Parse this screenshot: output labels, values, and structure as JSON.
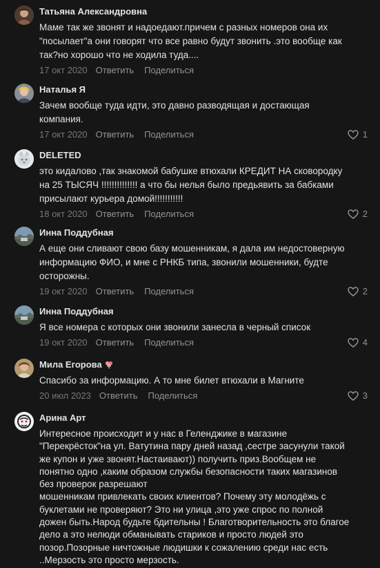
{
  "comments": [
    {
      "author": "Татьяна Александровна",
      "text": "Маме так же звонят и надоедают.причем с разных номеров она их\n\"посылает\"а они говорят что все равно будут звонить .это вообще как\nтак?но хорошо что не ходила туда....",
      "date": "17 окт 2020",
      "reply": "Ответить",
      "share": "Поделиться",
      "likes": ""
    },
    {
      "author": "Наталья Я",
      "text": "Зачем вообще туда идти, это давно разводящая и достающая\nкомпания.",
      "date": "17 окт 2020",
      "reply": "Ответить",
      "share": "Поделиться",
      "likes": "1"
    },
    {
      "author": "DELETED",
      "text": "это кидалово ,так знакомой бабушке втюхали КРЕДИТ НА сковородку\nна 25 ТЫСЯЧ !!!!!!!!!!!!!! а что бы нелья было предьявить за бабками\nприсылают курьера домой!!!!!!!!!!!",
      "date": "18 окт 2020",
      "reply": "Ответить",
      "share": "Поделиться",
      "likes": "2"
    },
    {
      "author": "Инна Поддубная",
      "text": "А еще они сливают свою базу мошенникам, я дала им недостоверную\nинформацию ФИО, и мне с РНКБ типа, звонили мошенники, будте\nосторожны.",
      "date": "19 окт 2020",
      "reply": "Ответить",
      "share": "Поделиться",
      "likes": "2"
    },
    {
      "author": "Инна Поддубная",
      "text": "Я все номера с которых они звонили занесла в черный список",
      "date": "19 окт 2020",
      "reply": "Ответить",
      "share": "Поделиться",
      "likes": "4"
    },
    {
      "author": "Мила Егорова",
      "text": "Спасибо за информацию. А то мне билет втюхали в Магните",
      "date": "20 июл 2023",
      "reply": "Ответить",
      "share": "Поделиться",
      "likes": "3"
    },
    {
      "author": "Арина Арт",
      "text": "Интересное происходит и у нас в Геленджике в магазине\n\"Перекрёсток\"на ул. Ватутина пару дней назад ,сестре засунули такой\nже купон и уже звонят.Настаивают)) получить приз.Вообщем не\nпонятно одно ,каким образом службы безопасности таких магазинов\nбез проверок разрешают\nмошенникам привлекать своих клиентов? Почему эту молодёжь с\nбуклетами не проверяют? Это ни улица ,это уже спрос по полной\nдожен быть.Народ будьте бдительны ! Благотворительность это благое\nдело а это нелюди обманывать стариков и просто людей это\nпозор.Позорные ничтожные людишки к сожалению среди нас есть\n..Мерзость это просто мерзость.",
      "date": "",
      "reply": "",
      "share": "",
      "likes": ""
    }
  ],
  "icons": {
    "like": "heart-outline-icon",
    "badge": "flower-emoji-icon"
  },
  "colors": {
    "background": "#161616",
    "text": "#e1e3e6",
    "muted": "#76787a",
    "action": "#939393"
  }
}
